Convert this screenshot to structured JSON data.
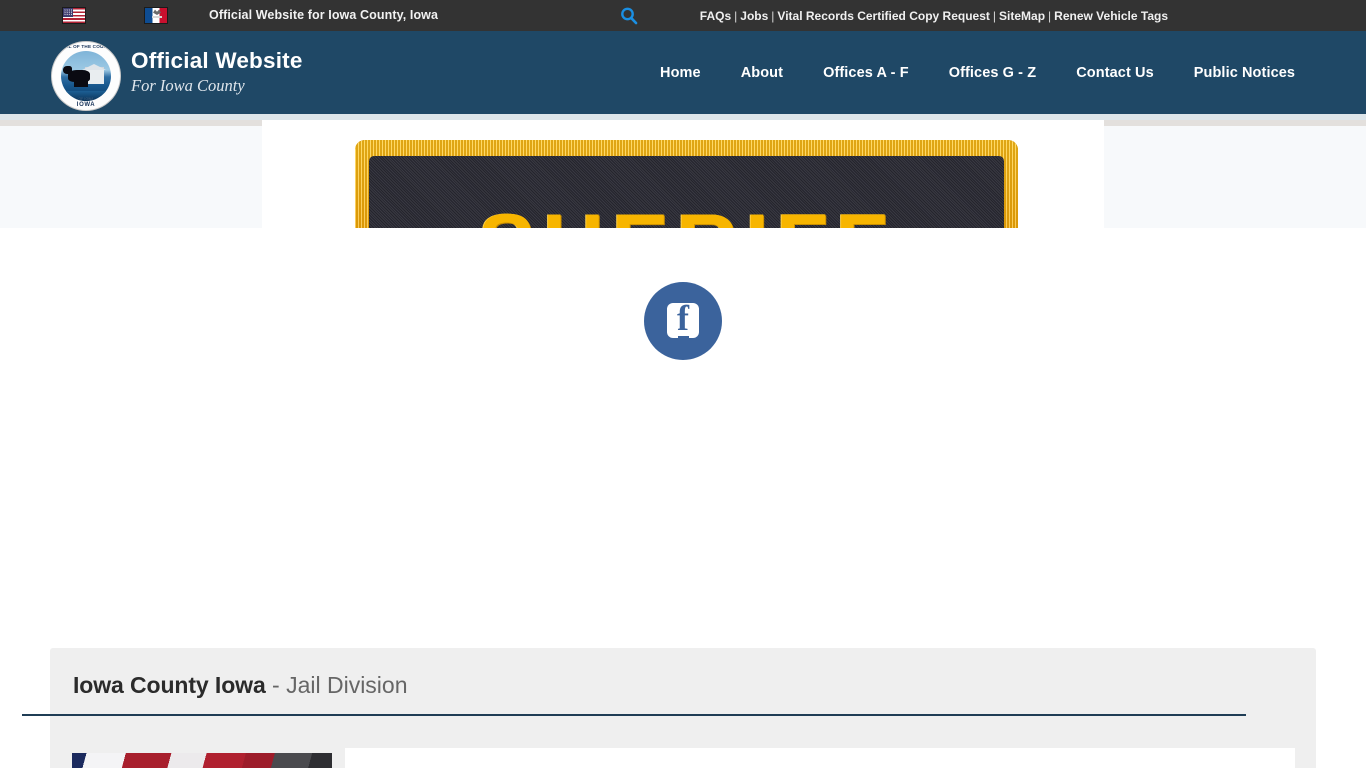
{
  "topbar": {
    "flag_us_name": "united-states-flag",
    "flag_ia_name": "iowa-state-flag",
    "title": "Official Website for Iowa County, Iowa",
    "search_icon": "search-icon",
    "links": [
      {
        "label": "FAQs"
      },
      {
        "label": "Jobs"
      },
      {
        "label": "Vital Records Certified Copy Request"
      },
      {
        "label": "SiteMap"
      },
      {
        "label": "Renew Vehicle Tags"
      }
    ],
    "separator": "|",
    "background_color": "#333333",
    "search_icon_color": "#1a8fe3"
  },
  "header": {
    "background_color": "#1f4866",
    "logo": {
      "name": "iowa-county-seal-logo",
      "ring_text_top": "SEAL OF THE COUNTY",
      "ring_text_sub": "OF IOWA",
      "ring_text_bottom": "IOWA"
    },
    "brand_line1": "Official Website",
    "brand_line2": "For Iowa County",
    "nav": [
      {
        "label": "Home"
      },
      {
        "label": "About"
      },
      {
        "label": "Offices A - F"
      },
      {
        "label": "Offices G - Z"
      },
      {
        "label": "Contact Us"
      },
      {
        "label": "Public Notices"
      }
    ]
  },
  "banner": {
    "name": "sheriff-patch-banner",
    "alt_text": "SHERIFF",
    "patch_word": "SHERIFF",
    "patch_border_color": "#f5a800",
    "patch_field_color": "#2e2e38",
    "patch_text_color": "#f7b500"
  },
  "social": {
    "facebook": {
      "name": "facebook-link",
      "label": "f",
      "color": "#3b639c"
    }
  },
  "content": {
    "title_strong": "Iowa County Iowa",
    "title_light": " - Jail Division",
    "rule_color": "#1f3d55",
    "card_background": "#efefef",
    "side_image_name": "american-flag-photo"
  }
}
